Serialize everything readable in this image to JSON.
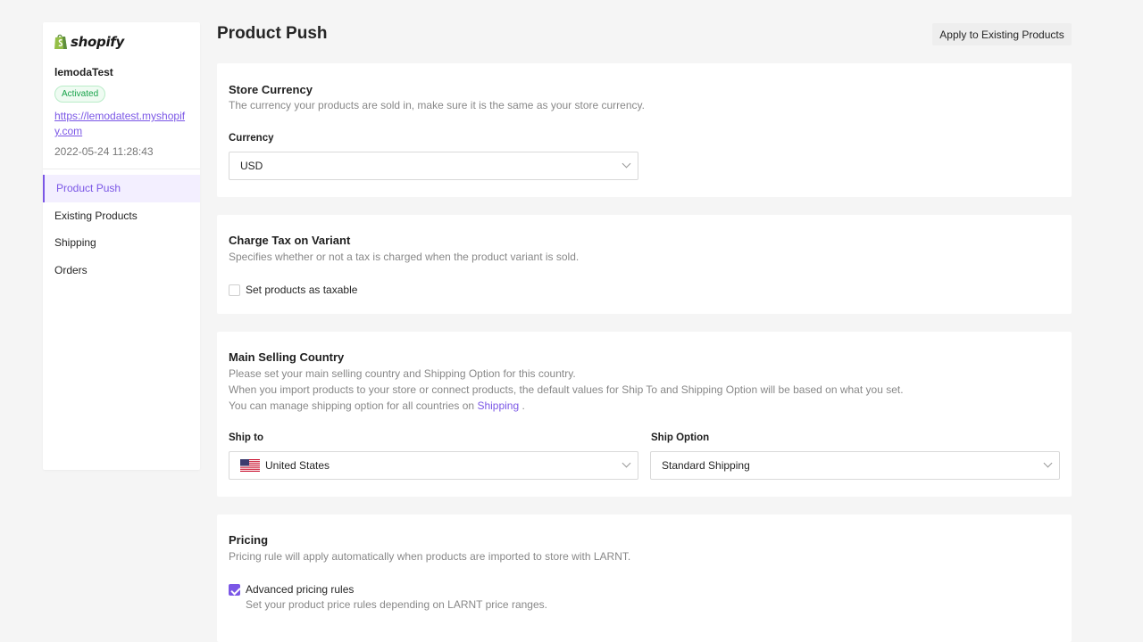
{
  "sidebar": {
    "logo_text": "shopify",
    "store_name": "lemodaTest",
    "status": "Activated",
    "store_url": "https://lemodatest.myshopify.com",
    "created_at": "2022-05-24 11:28:43",
    "nav": [
      {
        "label": "Product Push",
        "active": true
      },
      {
        "label": "Existing Products",
        "active": false
      },
      {
        "label": "Shipping",
        "active": false
      },
      {
        "label": "Orders",
        "active": false
      }
    ]
  },
  "header": {
    "title": "Product Push",
    "apply_button": "Apply to Existing Products"
  },
  "currency_card": {
    "title": "Store Currency",
    "description": "The currency your products are sold in, make sure it is the same as your store currency.",
    "field_label": "Currency",
    "selected": "USD"
  },
  "tax_card": {
    "title": "Charge Tax on Variant",
    "description": "Specifies whether or not a tax is charged when the product variant is sold.",
    "checkbox_label": "Set products as taxable",
    "checked": false
  },
  "country_card": {
    "title": "Main Selling Country",
    "line1": "Please set your main selling country and Shipping Option for this country.",
    "line2": "When you import products to your store or connect products, the default values for Ship To and Shipping Option will be based on what you set.",
    "line3_prefix": "You can manage shipping option for all countries on",
    "line3_link": "Shipping",
    "line3_suffix": ".",
    "ship_to_label": "Ship to",
    "ship_to_value": "United States",
    "ship_option_label": "Ship Option",
    "ship_option_value": "Standard Shipping"
  },
  "pricing_card": {
    "title": "Pricing",
    "description": "Pricing rule will apply automatically when products are imported to store with LARNT.",
    "checkbox_label": "Advanced pricing rules",
    "checkbox_hint": "Set your product price rules depending on LARNT price ranges.",
    "checked": true
  },
  "colors": {
    "accent": "#7b57e6",
    "success": "#17a34a",
    "background": "#f5f5f5"
  }
}
